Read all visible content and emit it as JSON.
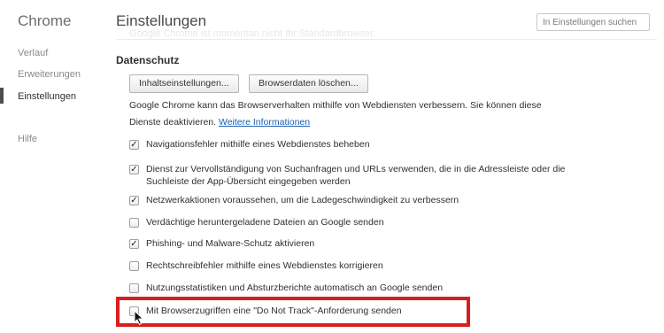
{
  "sidebar": {
    "title": "Chrome",
    "items": [
      {
        "label": "Verlauf"
      },
      {
        "label": "Erweiterungen"
      },
      {
        "label": "Einstellungen",
        "active": true
      },
      {
        "label": "Hilfe"
      }
    ]
  },
  "header": {
    "title": "Einstellungen",
    "ghost_text": "Google Chrome ist momentan nicht Ihr Standardbrowser.",
    "search_placeholder": "In Einstellungen suchen"
  },
  "privacy": {
    "section_title": "Datenschutz",
    "content_settings_label": "Inhaltseinstellungen...",
    "clear_data_label": "Browserdaten löschen...",
    "description": "Google Chrome kann das Browserverhalten mithilfe von Webdiensten verbessern. Sie können diese Dienste deaktivieren.",
    "more_info_link": "Weitere Informationen",
    "options": [
      {
        "label": "Navigationsfehler mithilfe eines Webdienstes beheben",
        "checked": true
      },
      {
        "label": "Dienst zur Vervollständigung von Suchanfragen und URLs verwenden, die in die Adressleiste oder die Suchleiste der App-Übersicht eingegeben werden",
        "checked": true
      },
      {
        "label": "Netzwerkaktionen voraussehen, um die Ladegeschwindigkeit zu verbessern",
        "checked": true
      },
      {
        "label": "Verdächtige heruntergeladene Dateien an Google senden",
        "checked": false
      },
      {
        "label": "Phishing- und Malware-Schutz aktivieren",
        "checked": true
      },
      {
        "label": "Rechtschreibfehler mithilfe eines Webdienstes korrigieren",
        "checked": false
      },
      {
        "label": "Nutzungsstatistiken und Absturzberichte automatisch an Google senden",
        "checked": false
      },
      {
        "label": "Mit Browserzugriffen eine \"Do Not Track\"-Anforderung senden",
        "checked": false
      }
    ]
  },
  "colors": {
    "highlight": "#d81e1e",
    "link": "#1a5fb4"
  }
}
